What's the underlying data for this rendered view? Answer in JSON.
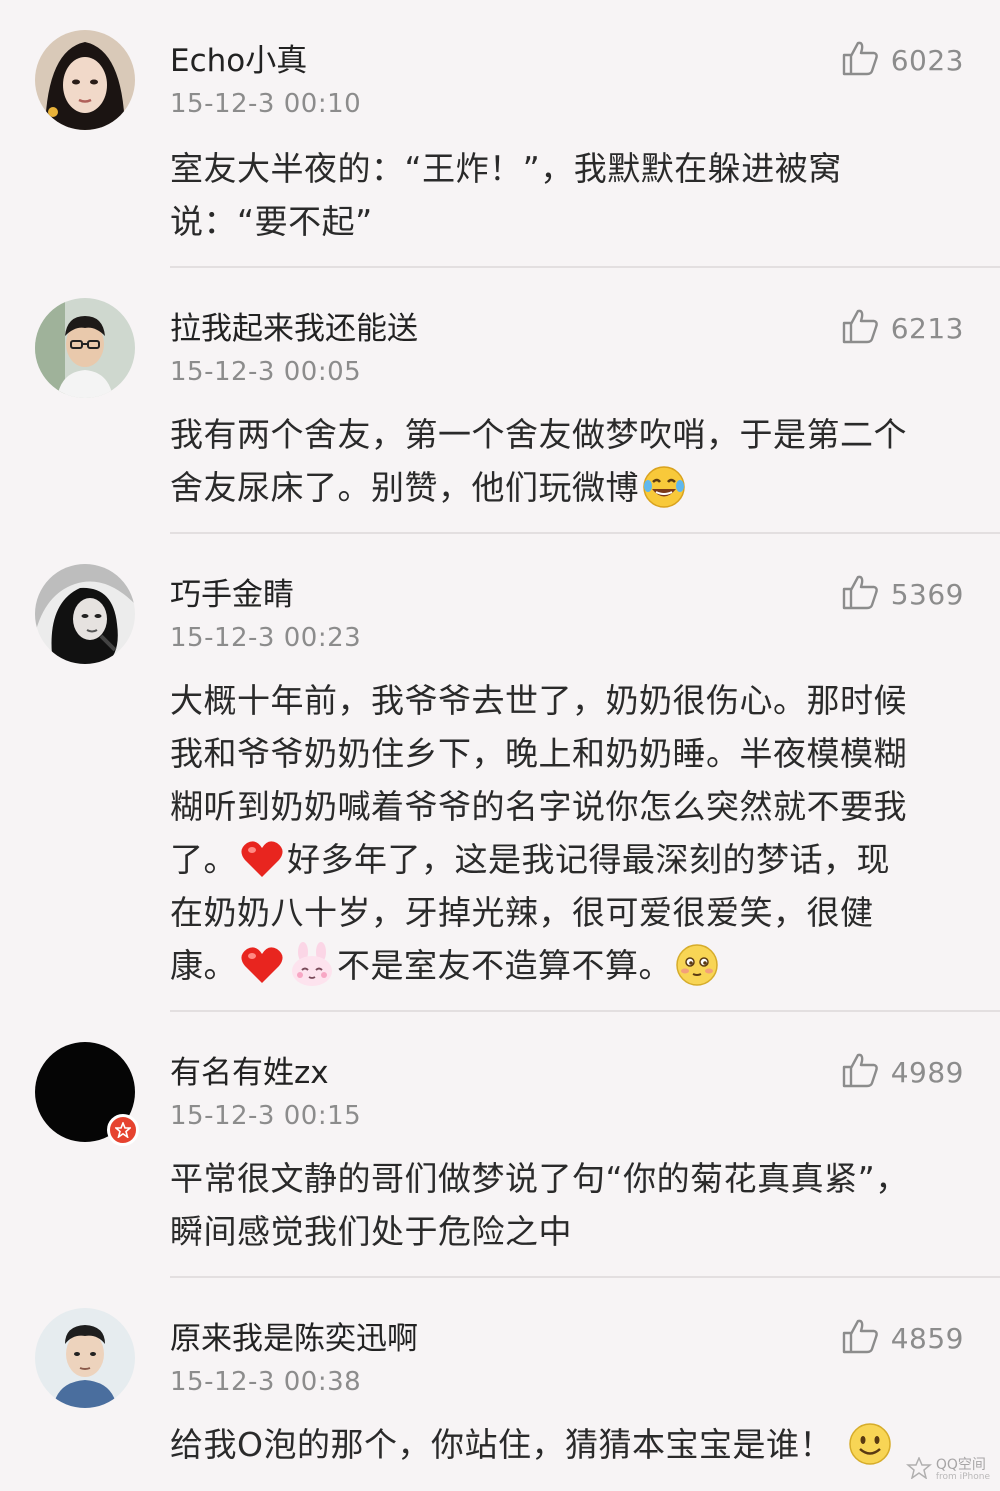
{
  "comments": [
    {
      "username": "Echo小真",
      "time": "15-12-3 00:10",
      "likes": "6023",
      "lines": [
        "室友大半夜的：“王炸！”，我默默在躲进被窝",
        "说：“要不起”"
      ]
    },
    {
      "username": "拉我起来我还能送",
      "time": "15-12-3 00:05",
      "likes": "6213",
      "lines": [
        "我有两个舍友，第一个舍友做梦吹哨，于是第二个",
        "舍友尿床了。别赞，他们玩微博"
      ]
    },
    {
      "username": "巧手金睛",
      "time": "15-12-3 00:23",
      "likes": "5369",
      "lines": [
        "大概十年前，我爷爷去世了，奶奶很伤心。那时候",
        "我和爷爷奶奶住乡下，晚上和奶奶睡。半夜模模糊",
        "糊听到奶奶喊着爷爷的名字说你怎么突然就不要我",
        "了。",
        "好多年了，这是我记得最深刻的梦话，现",
        "在奶奶八十岁，牙掉光辣，很可爱很爱笑，很健",
        "康。",
        "不是室友不造算不算。"
      ]
    },
    {
      "username": "有名有姓zx",
      "time": "15-12-3 00:15",
      "likes": "4989",
      "lines": [
        "平常很文静的哥们做梦说了句“你的菊花真真紧”，",
        "瞬间感觉我们处于危险之中"
      ]
    },
    {
      "username": "原来我是陈奕迅啊",
      "time": "15-12-3 00:38",
      "likes": "4859",
      "lines": [
        "给我O泡的那个，你站住，猜猜本宝宝是谁！"
      ]
    }
  ],
  "icons": {
    "like": "thumbs-up-icon",
    "emoji_laugh": "laughing-tears-emoji",
    "emoji_heart": "red-heart-emoji",
    "emoji_bunny": "pink-bunny-emoji",
    "emoji_blush": "shy-face-emoji",
    "emoji_smile": "smile-face-emoji",
    "verified": "verified-badge-icon"
  },
  "colors": {
    "background": "#f7f4f5",
    "text": "#2a2a2a",
    "meta": "#8c8c8c",
    "divider": "#e3dfe0",
    "badge": "#e6432f"
  },
  "watermark": {
    "title": "QQ空间",
    "subtitle": "from iPhone"
  }
}
